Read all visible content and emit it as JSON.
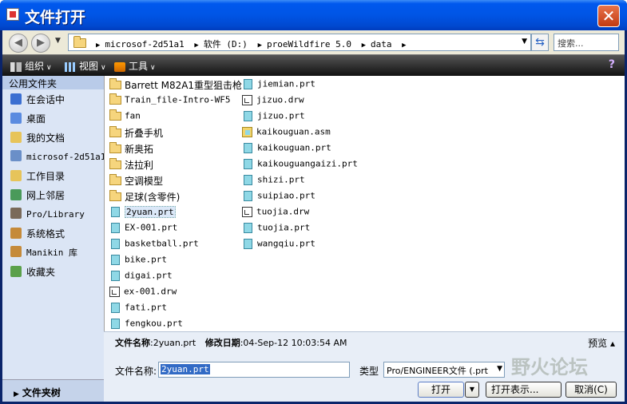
{
  "window": {
    "title": "文件打开",
    "close_label": "✕"
  },
  "address": {
    "crumbs": [
      "microsof-2d51a1",
      "软件 (D:)",
      "proeWildfire 5.0",
      "data"
    ],
    "search_placeholder": "搜索..."
  },
  "toolbar": {
    "organize": "组织",
    "view": "视图",
    "tools": "工具"
  },
  "sidebar": {
    "header": "公用文件夹",
    "items": [
      {
        "label": "在会话中",
        "icon": "monitor-icon",
        "color": "#3b6fd1"
      },
      {
        "label": "桌面",
        "icon": "desktop-icon",
        "color": "#5a8be0"
      },
      {
        "label": "我的文档",
        "icon": "documents-folder-icon",
        "color": "#e7c45a"
      },
      {
        "label": "microsof-2d51a1",
        "icon": "computer-icon",
        "color": "#6a8fc8"
      },
      {
        "label": "工作目录",
        "icon": "working-dir-icon",
        "color": "#e7c45a"
      },
      {
        "label": "网上邻居",
        "icon": "network-icon",
        "color": "#4a9a5a"
      },
      {
        "label": "Pro/Library",
        "icon": "library-icon",
        "color": "#7a6a5a"
      },
      {
        "label": "系统格式",
        "icon": "system-format-icon",
        "color": "#c58a3a"
      },
      {
        "label": "Manikin 库",
        "icon": "manikin-icon",
        "color": "#c58a3a"
      },
      {
        "label": "收藏夹",
        "icon": "favorites-icon",
        "color": "#5aa04a"
      }
    ],
    "footer": "文件夹树"
  },
  "files": {
    "col1": [
      {
        "name": "Barrett M82A1重型狙击枪",
        "type": "folder"
      },
      {
        "name": "Train_file-Intro-WF5",
        "type": "folder"
      },
      {
        "name": "fan",
        "type": "folder"
      },
      {
        "name": "折叠手机",
        "type": "folder"
      },
      {
        "name": "新奥拓",
        "type": "folder"
      },
      {
        "name": "法拉利",
        "type": "folder"
      },
      {
        "name": "空调模型",
        "type": "folder"
      },
      {
        "name": "足球(含零件)",
        "type": "folder"
      },
      {
        "name": "2yuan.prt",
        "type": "prt",
        "selected": true
      },
      {
        "name": "EX-001.prt",
        "type": "prt"
      },
      {
        "name": "basketball.prt",
        "type": "prt"
      },
      {
        "name": "bike.prt",
        "type": "prt"
      },
      {
        "name": "digai.prt",
        "type": "prt"
      },
      {
        "name": "ex-001.drw",
        "type": "drw"
      },
      {
        "name": "fati.prt",
        "type": "prt"
      },
      {
        "name": "fengkou.prt",
        "type": "prt"
      }
    ],
    "col2": [
      {
        "name": "jiemian.prt",
        "type": "prt"
      },
      {
        "name": "jizuo.drw",
        "type": "drw"
      },
      {
        "name": "jizuo.prt",
        "type": "prt"
      },
      {
        "name": "kaikouguan.asm",
        "type": "asm"
      },
      {
        "name": "kaikouguan.prt",
        "type": "prt"
      },
      {
        "name": "kaikouguangaizi.prt",
        "type": "prt"
      },
      {
        "name": "shizi.prt",
        "type": "prt"
      },
      {
        "name": "suipiao.prt",
        "type": "prt"
      },
      {
        "name": "tuojia.drw",
        "type": "drw"
      },
      {
        "name": "tuojia.prt",
        "type": "prt"
      },
      {
        "name": "wangqiu.prt",
        "type": "prt"
      }
    ]
  },
  "info": {
    "filename_label": "文件名称",
    "filename_value": ":2yuan.prt",
    "modified_label": "修改日期",
    "modified_value": ":04-Sep-12 10:03:54 AM",
    "preview": "预览 ▴"
  },
  "controls": {
    "filename_label": "文件名称:",
    "filename_value": "2yuan.prt",
    "type_label": "类型",
    "type_value": "Pro/ENGINEER文件 (.prt",
    "open": "打开",
    "open_show": "打开表示...",
    "cancel": "取消(C)"
  },
  "watermark": "野火论坛"
}
